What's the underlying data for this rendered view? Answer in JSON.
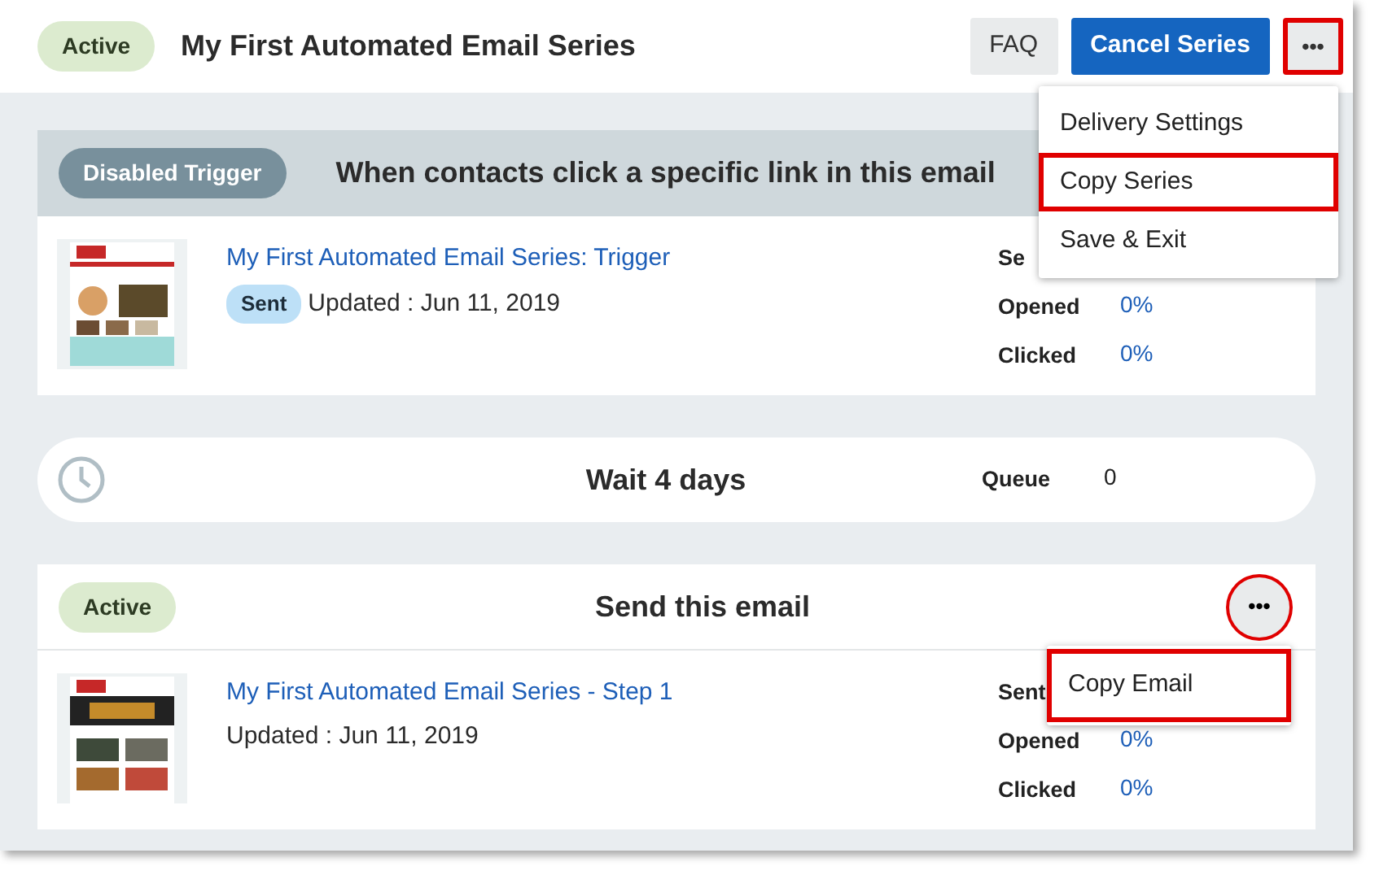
{
  "header": {
    "status": "Active",
    "title": "My First Automated Email Series",
    "buttons": [
      {
        "label": "FAQ",
        "kind": "secondary",
        "highlighted": false
      },
      {
        "label": "Cancel Series",
        "kind": "primary",
        "highlighted": false
      },
      {
        "label": "•••",
        "kind": "more",
        "highlighted": true
      }
    ]
  },
  "menu": {
    "items": [
      {
        "label": "Delivery Settings",
        "highlighted": false
      },
      {
        "label": "Copy Series",
        "highlighted": true
      },
      {
        "label": "Save & Exit",
        "highlighted": false
      }
    ]
  },
  "steps": [
    {
      "kind": "email",
      "status": "Disabled Trigger",
      "disabled": true,
      "title": "When contacts click a specific link in this email",
      "email_link": "My First Automated Email Series: Trigger",
      "sent_badge": "Sent",
      "updated": "Updated : Jun 11, 2019",
      "stats": [
        {
          "label": "Se"
        },
        {
          "label": "Opened",
          "value": "0%"
        },
        {
          "label": "Clicked",
          "value": "0%"
        }
      ]
    },
    {
      "kind": "wait",
      "title": "Wait 4 days",
      "queue_label": "Queue",
      "queue_value": "0"
    },
    {
      "kind": "email",
      "status": "Active",
      "disabled": false,
      "title": "Send this email",
      "more": {
        "label": "•••",
        "highlighted": true
      },
      "menu": {
        "items": [
          {
            "label": "Copy Email",
            "highlighted": true
          }
        ]
      },
      "email_link": "My First Automated Email Series - Step 1",
      "updated": "Updated : Jun 11, 2019",
      "stats": [
        {
          "label": "Sent"
        },
        {
          "label": "Opened",
          "value": "0%"
        },
        {
          "label": "Clicked",
          "value": "0%"
        }
      ]
    }
  ]
}
